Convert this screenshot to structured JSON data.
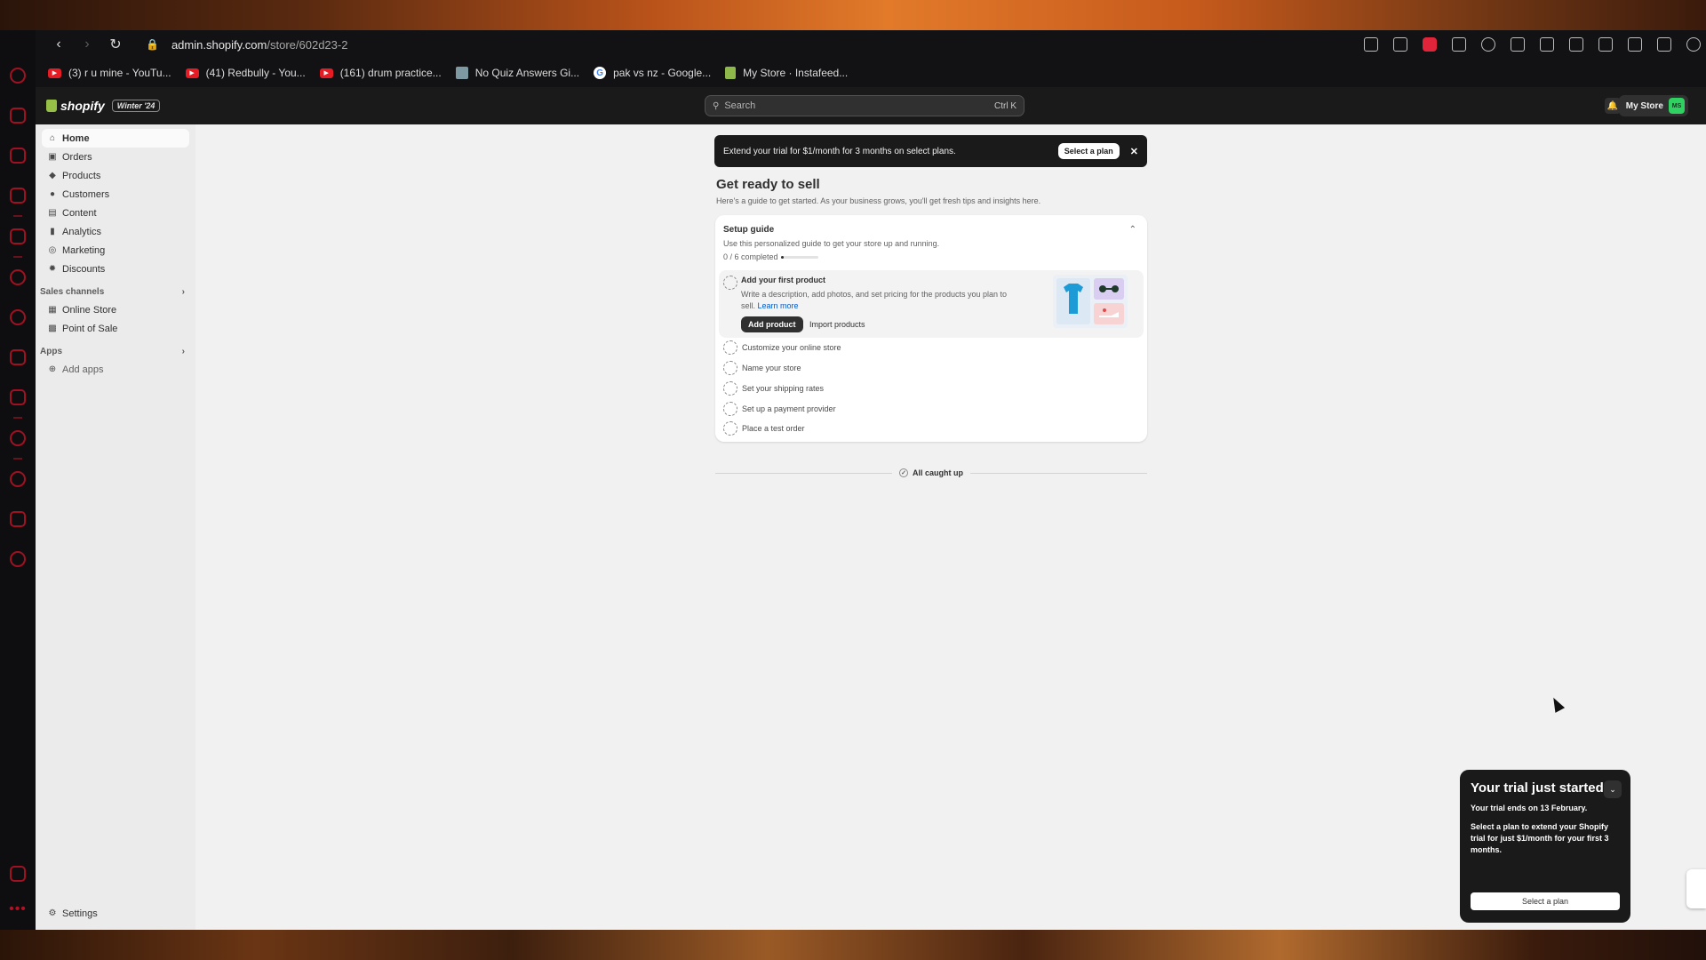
{
  "browser": {
    "url_domain": "admin.shopify.com",
    "url_path": "/store/602d23-2",
    "bookmarks": [
      {
        "label": "(3) r u mine - YouTu...",
        "icon": "youtube-icon"
      },
      {
        "label": "(41) Redbully - You...",
        "icon": "youtube-icon"
      },
      {
        "label": "(161) drum practice...",
        "icon": "youtube-icon"
      },
      {
        "label": "No Quiz Answers Gi...",
        "icon": "quiz-icon"
      },
      {
        "label": "pak vs nz - Google...",
        "icon": "google-icon"
      },
      {
        "label": "My Store · Instafeed...",
        "icon": "shopify-icon"
      }
    ]
  },
  "topbar": {
    "brand": "shopify",
    "edition": "Winter '24",
    "search_placeholder": "Search",
    "search_shortcut": "Ctrl K",
    "store_name": "My Store",
    "store_initials": "MS"
  },
  "sidebar": {
    "items": [
      "Home",
      "Orders",
      "Products",
      "Customers",
      "Content",
      "Analytics",
      "Marketing",
      "Discounts"
    ],
    "sales_channels_label": "Sales channels",
    "sales_channels": [
      "Online Store",
      "Point of Sale"
    ],
    "apps_label": "Apps",
    "add_apps": "Add apps",
    "settings": "Settings"
  },
  "banner": {
    "text": "Extend your trial for $1/month for 3 months on select plans.",
    "button": "Select a plan"
  },
  "page": {
    "title": "Get ready to sell",
    "subtitle": "Here's a guide to get started. As your business grows, you'll get fresh tips and insights here."
  },
  "setup_guide": {
    "title": "Setup guide",
    "description": "Use this personalized guide to get your store up and running.",
    "progress_text": "0 / 6 completed",
    "progress_fraction": 0,
    "active_step": {
      "title": "Add your first product",
      "description": "Write a description, add photos, and set pricing for the products you plan to sell.",
      "learn_more": "Learn more",
      "primary_button": "Add product",
      "secondary_button": "Import products"
    },
    "steps": [
      "Customize your online store",
      "Name your store",
      "Set your shipping rates",
      "Set up a payment provider",
      "Place a test order"
    ]
  },
  "caught_up": "All caught up",
  "trial_popup": {
    "title": "Your trial just started",
    "ends": "Your trial ends on 13 February.",
    "body": "Select a plan to extend your Shopify trial for just $1/month for your first 3 months.",
    "button": "Select a plan"
  },
  "colors": {
    "dark": "#1a1a1a",
    "accent_green": "#95bf47",
    "link": "#005bd3",
    "dock_red": "#b01225"
  }
}
